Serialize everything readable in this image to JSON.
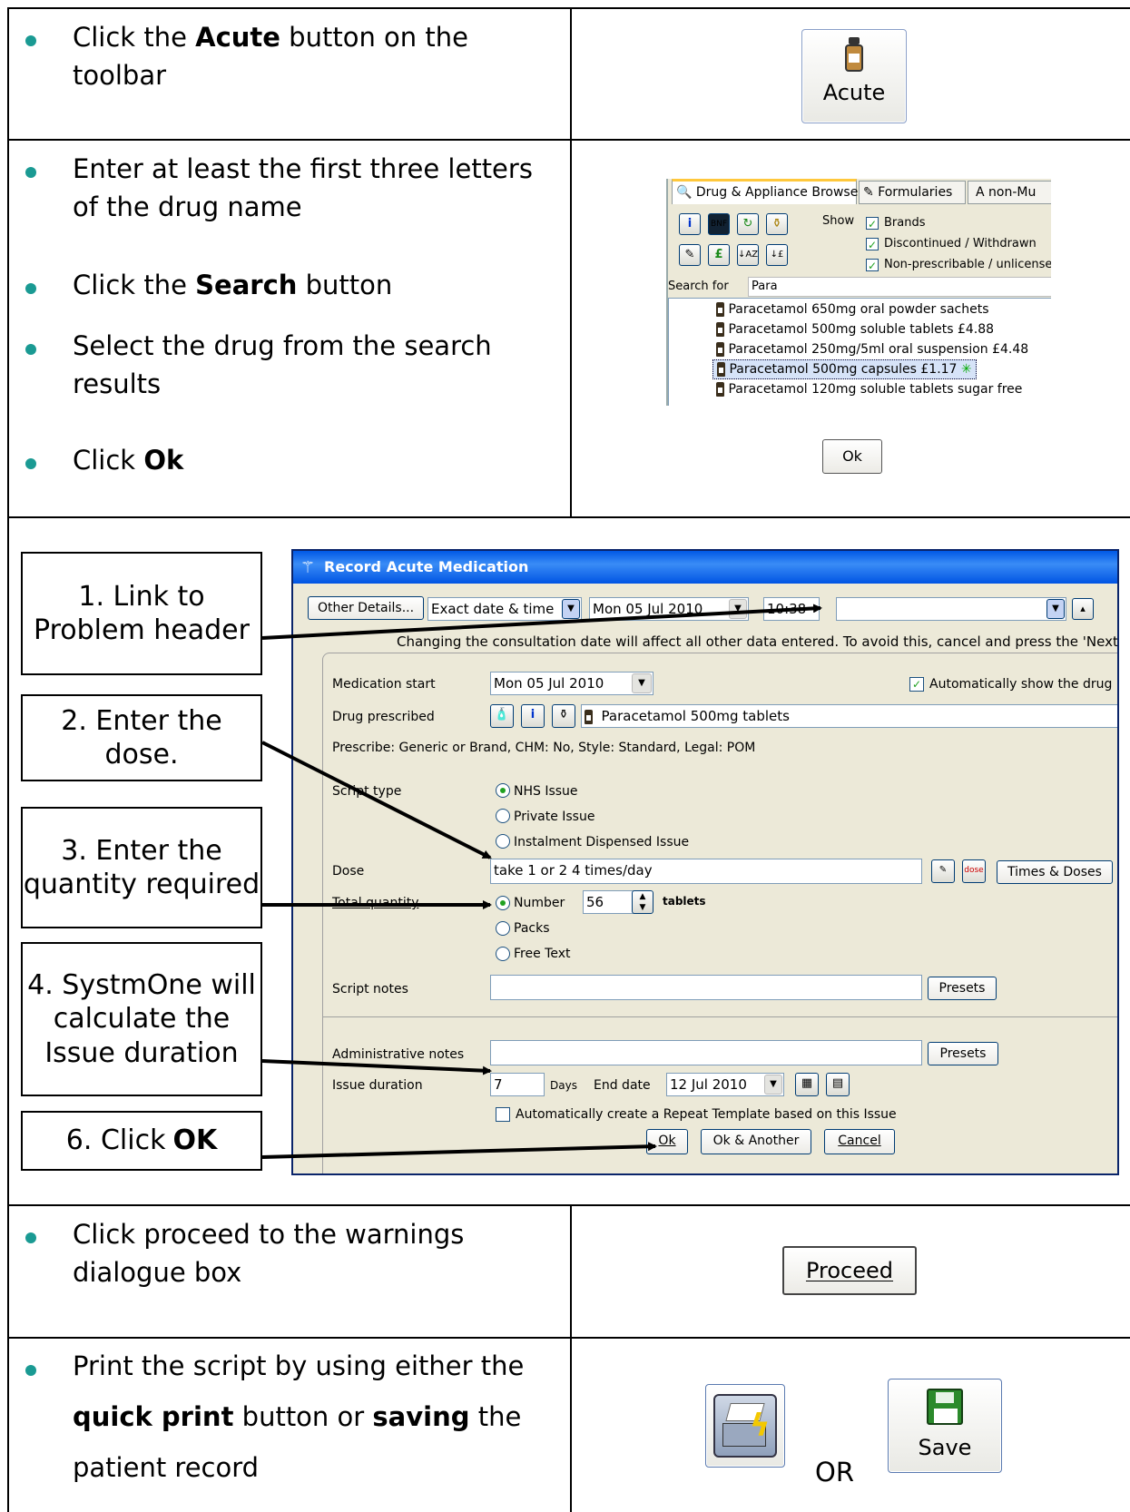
{
  "step1": {
    "text_a": "Click the ",
    "bold": "Acute",
    "text_b": " button on the toolbar",
    "button_label": "Acute"
  },
  "step2": {
    "bullets": [
      {
        "pre": "Enter at least the first three letters of the drug name",
        "bold": "",
        "post": ""
      },
      {
        "pre": "Click the ",
        "bold": "Search",
        "post": " button"
      },
      {
        "pre": "Select the drug from the search results",
        "bold": "",
        "post": ""
      },
      {
        "pre": "Click ",
        "bold": "Ok",
        "post": ""
      }
    ],
    "browser": {
      "tabs": [
        "Drug & Appliance Browser",
        "Formularies",
        "A  non-Mu"
      ],
      "show_label": "Show",
      "checkboxes": [
        "Brands",
        "Discontinued / Withdrawn",
        "Non-prescribable / unlicensed"
      ],
      "search_for_label": "Search for",
      "search_value": "Para",
      "results": [
        "Paracetamol 650mg oral powder sachets",
        "Paracetamol 500mg soluble tablets  £4.88",
        "Paracetamol 250mg/5ml oral suspension  £4.48",
        "Paracetamol 500mg capsules  £1.17",
        "Paracetamol 120mg soluble tablets sugar free"
      ]
    },
    "ok_label": "Ok"
  },
  "callouts": {
    "c1": "1. Link to Problem header",
    "c2": "2. Enter the dose.",
    "c3": "3. Enter the quantity required",
    "c4": "4. SystmOne will calculate the Issue duration",
    "c6_pre": "6. Click ",
    "c6_bold": "OK"
  },
  "dialog": {
    "title": "Record Acute Medication",
    "other_details": "Other Details...",
    "date_mode": "Exact date & time",
    "date": "Mon 05 Jul 2010",
    "time": "10:38",
    "warning": "Changing the consultation date will affect all other data entered. To avoid this, cancel and press the 'Next",
    "medication_start_label": "Medication start",
    "medication_start_value": "Mon 05 Jul 2010",
    "auto_show": "Automatically show the drug b",
    "drug_prescribed_label": "Drug prescribed",
    "drug_prescribed_value": "Paracetamol 500mg tablets",
    "prescribe_info": "Prescribe: Generic or Brand, CHM: No, Style: Standard, Legal: POM",
    "script_type_label": "Script type",
    "script_types": [
      "NHS Issue",
      "Private Issue",
      "Instalment Dispensed Issue"
    ],
    "dose_label": "Dose",
    "dose_value": "take 1 or 2 4 times/day",
    "times_doses": "Times & Doses",
    "total_quantity_label": "Total quantity",
    "quantity_options": [
      "Number",
      "Packs",
      "Free Text"
    ],
    "quantity_value": "56",
    "quantity_unit": "tablets",
    "script_notes_label": "Script notes",
    "presets": "Presets",
    "admin_notes_label": "Administrative notes",
    "issue_duration_label": "Issue duration",
    "issue_duration_value": "7",
    "days_label": "Days",
    "end_date_label": "End date",
    "end_date_value": "12 Jul 2010",
    "auto_repeat": "Automatically create a Repeat Template based on this Issue",
    "ok": "Ok",
    "ok_another": "Ok & Another",
    "cancel": "Cancel"
  },
  "step4": {
    "text": "Click proceed to the warnings dialogue box",
    "button_label": "Proceed"
  },
  "step5": {
    "pre": "Print the script by using either the ",
    "bold1": "quick print",
    "mid": " button or ",
    "bold2": "saving",
    "post": " the patient record",
    "or_label": "OR",
    "save_label": "Save"
  }
}
